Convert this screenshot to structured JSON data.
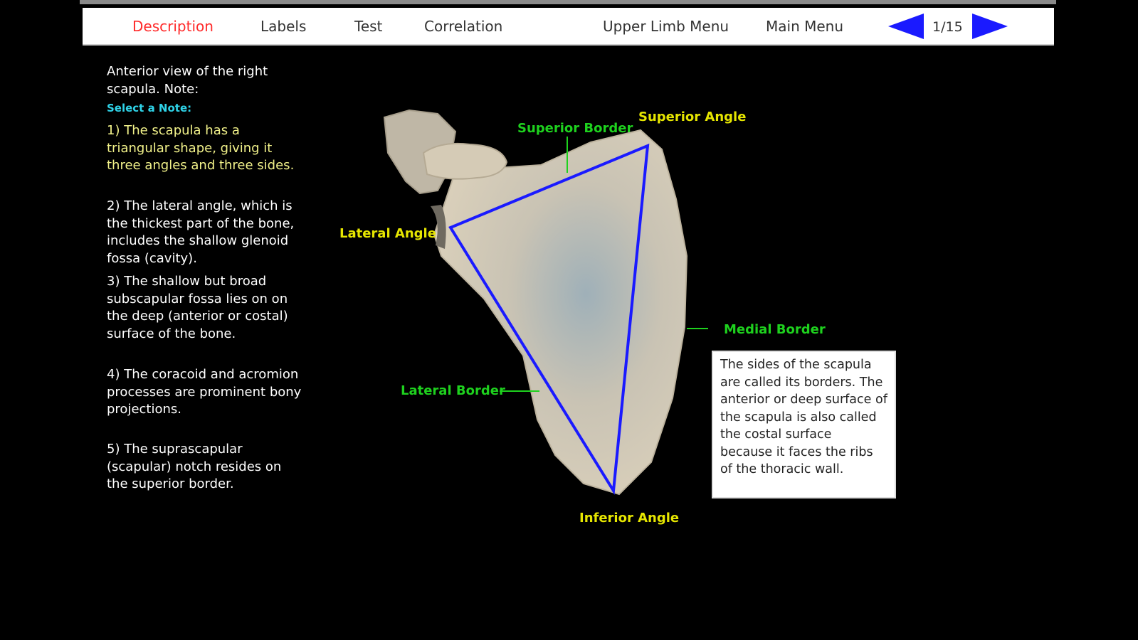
{
  "nav": {
    "tabs": [
      {
        "label": "Description"
      },
      {
        "label": "Labels"
      },
      {
        "label": "Test"
      },
      {
        "label": "Correlation"
      },
      {
        "label": "Upper Limb Menu"
      },
      {
        "label": "Main Menu"
      }
    ],
    "active_tab": "Description",
    "page_indicator": "1/15",
    "prev_icon": "left-arrow-icon",
    "next_icon": "right-arrow-icon",
    "arrow_color": "#1a1aff",
    "active_color": "#ff2a2a"
  },
  "intro": "Anterior view of the right scapula. Note:",
  "select_note": "Select a Note:",
  "notes": [
    "1) The scapula has a triangular shape, giving it three angles and three sides.",
    "2) The lateral angle, which is the thickest part of the bone, includes the shallow glenoid fossa (cavity).",
    "3) The shallow but broad subscapular fossa lies on on the deep (anterior or costal) surface of the bone.",
    "4) The coracoid and acromion processes are prominent bony projections.",
    "5) The suprascapular (scapular) notch resides on the superior border."
  ],
  "highlighted_note": 1,
  "labels": {
    "superior_border": "Superior Border",
    "superior_angle": "Superior Angle",
    "lateral_angle": "Lateral Angle",
    "medial_border": "Medial Border",
    "lateral_border": "Lateral Border",
    "inferior_angle": "Inferior Angle"
  },
  "info_text": "The sides of the scapula are called its borders. The anterior or deep surface of the scapula is also called the costal surface because it faces the ribs of the thoracic wall.",
  "colors": {
    "angle_labels": "#e6e600",
    "border_labels": "#1ed11e",
    "triangle": "#1a1aff",
    "bone": "#cfc6b2"
  }
}
